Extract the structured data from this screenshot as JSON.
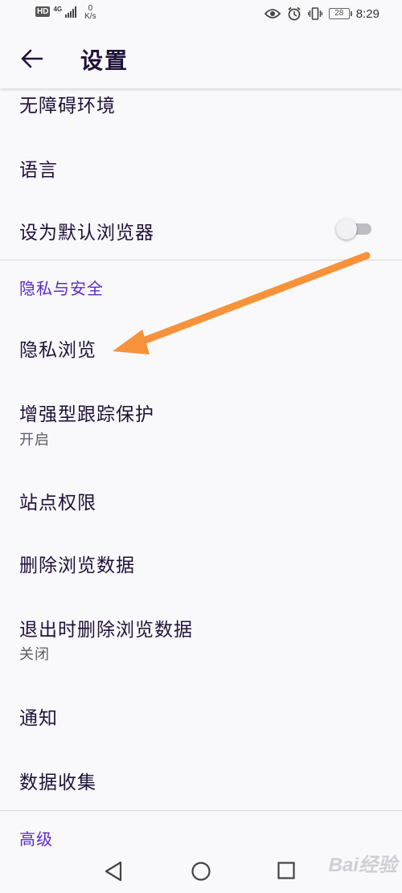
{
  "status_bar": {
    "hd": "HD",
    "network": "4G",
    "speed_value": "0",
    "speed_unit": "K/s",
    "battery": "28",
    "time": "8:29"
  },
  "app_bar": {
    "title": "设置"
  },
  "rows": {
    "accessibility": "无障碍环境",
    "language": "语言",
    "default_browser": "设为默认浏览器",
    "private_browsing": "隐私浏览",
    "tracking_protection": "增强型跟踪保护",
    "tracking_protection_state": "开启",
    "site_permissions": "站点权限",
    "delete_browsing_data": "删除浏览数据",
    "delete_on_quit": "退出时删除浏览数据",
    "delete_on_quit_state": "关闭",
    "notifications": "通知",
    "data_collection": "数据收集"
  },
  "sections": {
    "privacy_security": "隐私与安全",
    "advanced": "高级"
  },
  "toggle_default_browser_on": false,
  "watermark": "Bai经验",
  "colors": {
    "accent": "#592acb",
    "arrow": "#f7923a",
    "background": "#f9f9fb"
  }
}
